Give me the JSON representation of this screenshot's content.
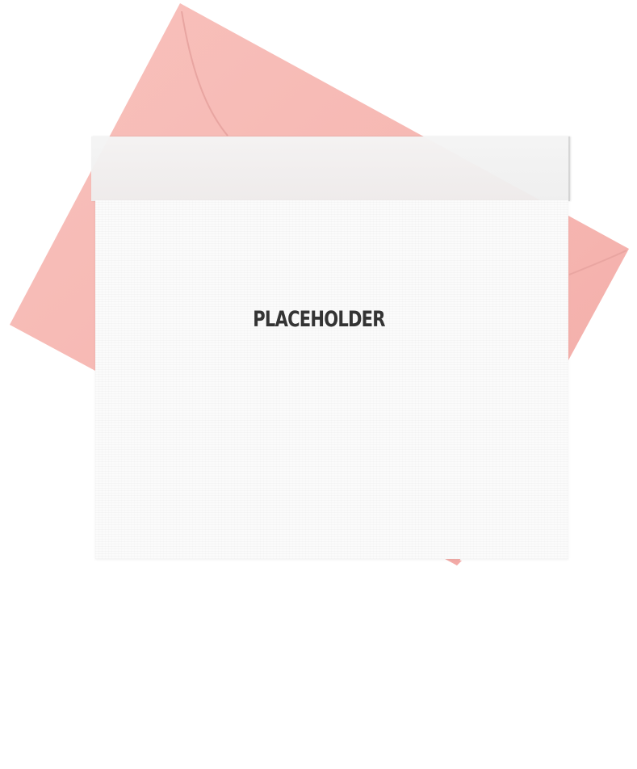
{
  "card": {
    "title": "PLACEHOLDER"
  },
  "colors": {
    "envelope": "#f7b9b5",
    "envelope_shadow": "#e9a39f",
    "card": "#fbfbfb",
    "title_text": "#343434"
  },
  "icons": {
    "envelope": "envelope-icon"
  }
}
